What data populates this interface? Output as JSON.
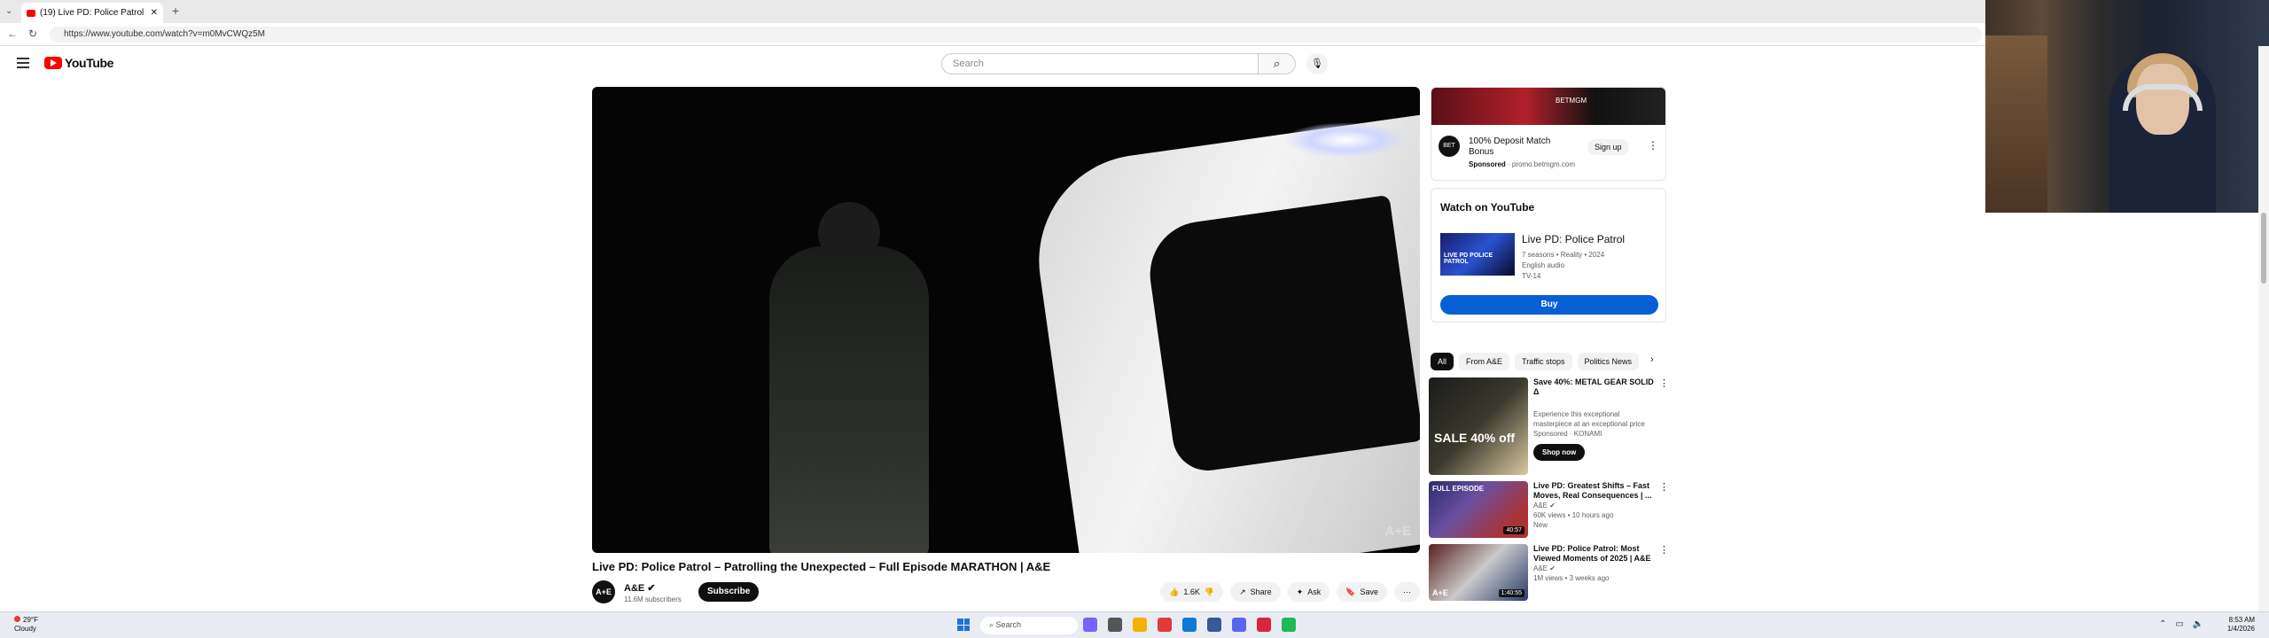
{
  "browser": {
    "tab_title": "(19) Live PD: Police Patrol – P...",
    "new_tab": "+",
    "url": "https://www.youtube.com/watch?v=m0MvCWQz5M"
  },
  "youtube": {
    "logo_text": "YouTube",
    "search_placeholder": "Search"
  },
  "video": {
    "title": "Live PD: Police Patrol – Patrolling the Unexpected – Full Episode MARATHON | A&E",
    "watermark": "A+E",
    "channel": {
      "avatar": "A+E",
      "name": "A&E ✔",
      "subscribers": "11.6M subscribers",
      "subscribe_label": "Subscribe"
    },
    "actions": {
      "likes": "1.6K",
      "share": "Share",
      "ask": "Ask",
      "save": "Save",
      "more": "⋯"
    }
  },
  "sidebar": {
    "ad": {
      "banner_text": "BETMGM",
      "logo": "BET",
      "title": "100% Deposit Match Bonus",
      "sponsored": "Sponsored",
      "domain": "· promo.betmgm.com",
      "cta": "Sign up"
    },
    "watch_on_youtube": {
      "heading": "Watch on YouTube",
      "thumb_text": "LIVE PD POLICE PATROL",
      "title": "Live PD: Police Patrol",
      "meta1": "7 seasons • Reality • 2024",
      "meta2": "English audio",
      "meta3": "TV-14",
      "buy": "Buy"
    },
    "chips": [
      "All",
      "From A&E",
      "Traffic stops",
      "Politics News"
    ],
    "recommendations": [
      {
        "thumb_text": "SALE 40% off",
        "title": "Save 40%: METAL GEAR SOLID Δ",
        "sub1": "Experience this exceptional masterpiece at an exceptional price",
        "sub2": "Sponsored · KONAMI",
        "cta": "Shop now",
        "duration": ""
      },
      {
        "thumb_text": "FULL EPISODE",
        "title": "Live PD: Greatest Shifts – Fast Moves, Real Consequences | ...",
        "sub1": "A&E ✔",
        "sub2": "60K views • 10 hours ago",
        "sub3": "New",
        "duration": "40:57"
      },
      {
        "thumb_text": "A+E",
        "title": "Live PD: Police Patrol: Most Viewed Moments of 2025 | A&E",
        "sub1": "A&E ✔",
        "sub2": "1M views • 3 weeks ago",
        "duration": "1:40:55"
      }
    ]
  },
  "taskbar": {
    "weather_temp": "29°F",
    "weather_desc": "Cloudy",
    "search": "Search",
    "time": "8:53 AM",
    "date": "1/4/2026"
  },
  "colors": {
    "youtube_red": "#ff0000",
    "buy_blue": "#065fd4",
    "subscribe_black": "#0f0f0f"
  }
}
